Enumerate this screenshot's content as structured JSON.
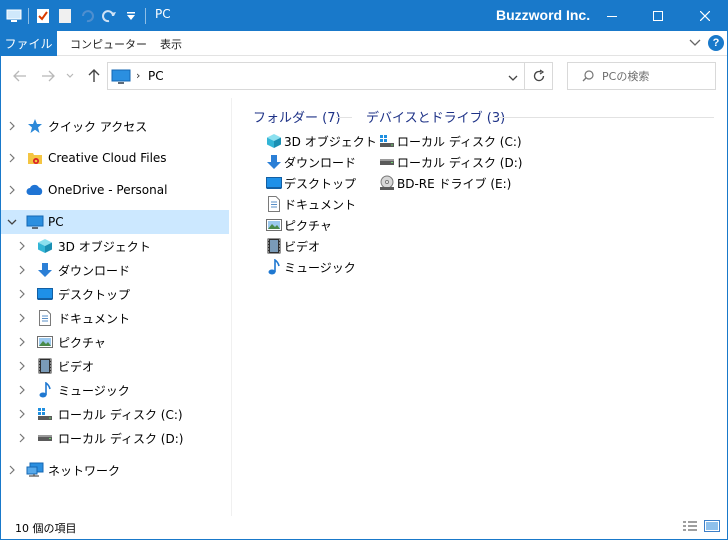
{
  "window": {
    "title": "PC",
    "brand": "Buzzword Inc.",
    "accent_color": "#1979ca",
    "quick_access_icons": [
      "pc-icon",
      "properties-icon",
      "new-folder-icon",
      "undo-icon",
      "redo-icon",
      "customize-dropdown-icon"
    ]
  },
  "ribbon": {
    "tabs": [
      "ファイル",
      "コンピューター",
      "表示"
    ],
    "active_tab": "ファイル"
  },
  "address": {
    "location": "PC",
    "search_placeholder": "PCの検索"
  },
  "nav": {
    "items": [
      {
        "label": "クイック アクセス",
        "icon": "star-icon",
        "level": 0
      },
      {
        "label": "Creative Cloud Files",
        "icon": "creative-cloud-folder-icon",
        "level": 0
      },
      {
        "label": "OneDrive - Personal",
        "icon": "cloud-icon",
        "level": 0
      },
      {
        "label": "PC",
        "icon": "pc-icon",
        "level": 0,
        "selected": true,
        "expanded": true
      },
      {
        "label": "3D オブジェクト",
        "icon": "3d-objects-icon",
        "level": 1
      },
      {
        "label": "ダウンロード",
        "icon": "download-icon",
        "level": 1
      },
      {
        "label": "デスクトップ",
        "icon": "desktop-icon",
        "level": 1
      },
      {
        "label": "ドキュメント",
        "icon": "document-icon",
        "level": 1
      },
      {
        "label": "ピクチャ",
        "icon": "picture-icon",
        "level": 1
      },
      {
        "label": "ビデオ",
        "icon": "video-icon",
        "level": 1
      },
      {
        "label": "ミュージック",
        "icon": "music-icon",
        "level": 1
      },
      {
        "label": "ローカル ディスク (C:)",
        "icon": "system-drive-icon",
        "level": 1
      },
      {
        "label": "ローカル ディスク (D:)",
        "icon": "drive-icon",
        "level": 1
      },
      {
        "label": "ネットワーク",
        "icon": "network-icon",
        "level": 0
      }
    ]
  },
  "content": {
    "folders_header": "フォルダー (7)",
    "folders": [
      {
        "label": "3D オブジェクト",
        "icon": "3d-objects-icon"
      },
      {
        "label": "ダウンロード",
        "icon": "download-icon"
      },
      {
        "label": "デスクトップ",
        "icon": "desktop-icon"
      },
      {
        "label": "ドキュメント",
        "icon": "document-icon"
      },
      {
        "label": "ピクチャ",
        "icon": "picture-icon"
      },
      {
        "label": "ビデオ",
        "icon": "video-icon"
      },
      {
        "label": "ミュージック",
        "icon": "music-icon"
      }
    ],
    "drives_header": "デバイスとドライブ (3)",
    "drives": [
      {
        "label": "ローカル ディスク (C:)",
        "icon": "system-drive-icon"
      },
      {
        "label": "ローカル ディスク (D:)",
        "icon": "drive-icon"
      },
      {
        "label": "BD-RE ドライブ (E:)",
        "icon": "optical-drive-icon"
      }
    ]
  },
  "status": {
    "item_count": "10 個の項目"
  }
}
